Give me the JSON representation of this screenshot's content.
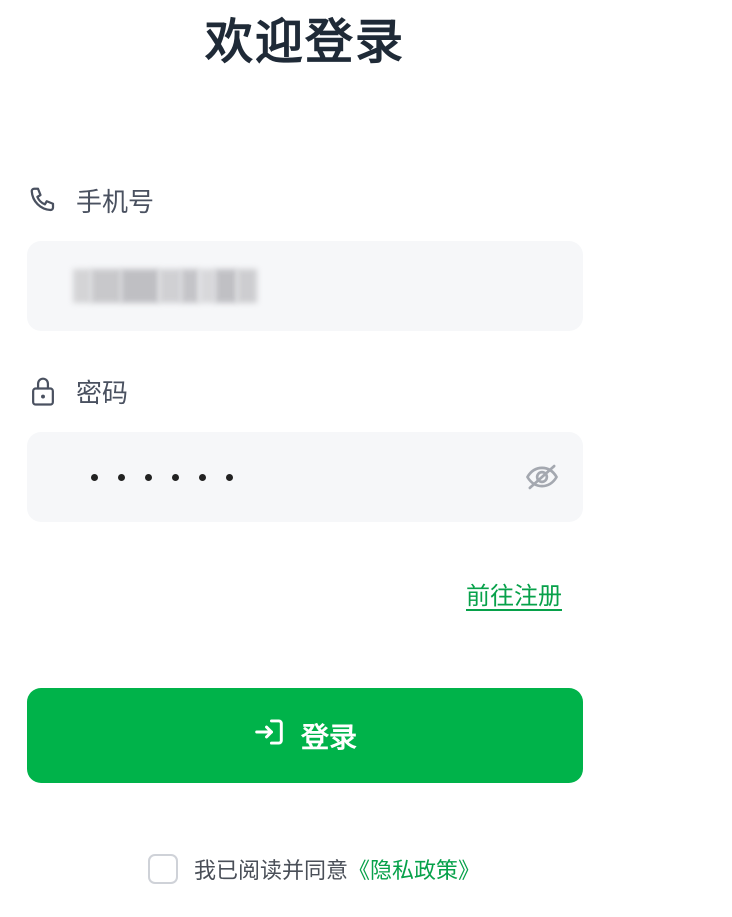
{
  "page_title": "欢迎登录",
  "phone": {
    "label": "手机号",
    "icon": "phone-icon",
    "value_obscured": true
  },
  "password": {
    "label": "密码",
    "icon": "lock-icon",
    "masked_length": 6,
    "toggle_icon": "eye-off-icon"
  },
  "register_link": "前往注册",
  "login_button": {
    "label": "登录",
    "icon": "login-arrow-icon"
  },
  "agreement": {
    "text": "我已阅读并同意",
    "policy_link": "《隐私政策》",
    "checked": false
  },
  "colors": {
    "accent": "#00b34a",
    "link": "#07a14a",
    "title": "#1f2a37",
    "input_bg": "#f6f7f9"
  }
}
